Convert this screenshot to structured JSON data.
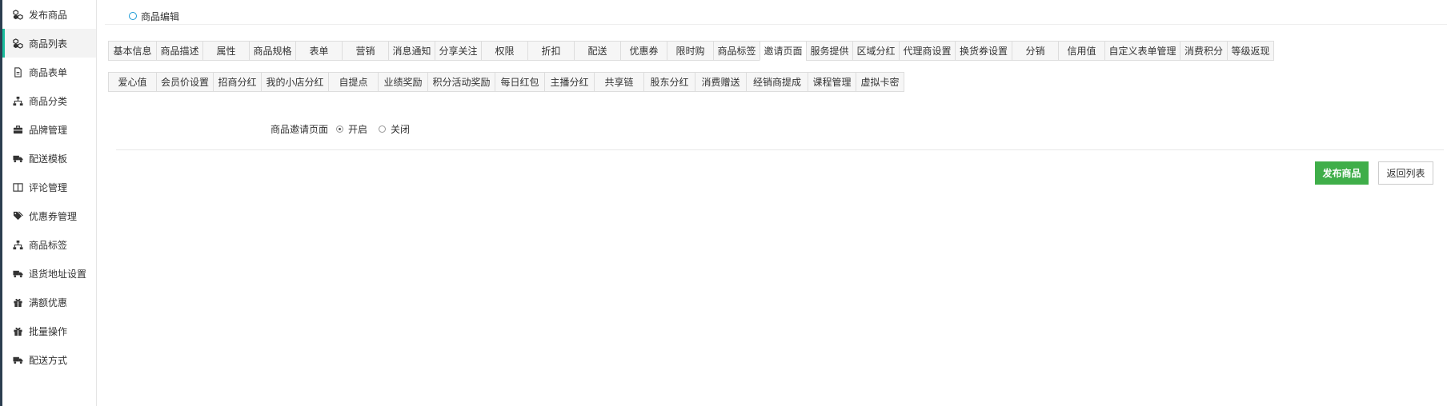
{
  "sidebar": {
    "items": [
      {
        "label": "发布商品",
        "icon": "cubes-icon"
      },
      {
        "label": "商品列表",
        "icon": "cubes-icon"
      },
      {
        "label": "商品表单",
        "icon": "file-icon"
      },
      {
        "label": "商品分类",
        "icon": "sitemap-icon"
      },
      {
        "label": "品牌管理",
        "icon": "briefcase-icon"
      },
      {
        "label": "配送模板",
        "icon": "truck-icon"
      },
      {
        "label": "评论管理",
        "icon": "columns-icon"
      },
      {
        "label": "优惠券管理",
        "icon": "tags-icon"
      },
      {
        "label": "商品标签",
        "icon": "sitemap-icon"
      },
      {
        "label": "退货地址设置",
        "icon": "truck-icon"
      },
      {
        "label": "满额优惠",
        "icon": "gift-icon"
      },
      {
        "label": "批量操作",
        "icon": "gift-icon"
      },
      {
        "label": "配送方式",
        "icon": "truck-icon"
      }
    ],
    "active_index": 1
  },
  "breadcrumb": {
    "label": "商品编辑"
  },
  "tabs": {
    "row1": [
      "基本信息",
      "商品描述",
      "属性",
      "商品规格",
      "表单",
      "营销",
      "消息通知",
      "分享关注",
      "权限",
      "折扣",
      "配送",
      "优惠券",
      "限时购",
      "商品标签",
      "邀请页面",
      "服务提供",
      "区域分红",
      "代理商设置",
      "换货券设置",
      "分销",
      "信用值",
      "自定义表单管理",
      "消费积分",
      "等级返现"
    ],
    "row2": [
      "爱心值",
      "会员价设置",
      "招商分红",
      "我的小店分红",
      "自提点",
      "业绩奖励",
      "积分活动奖励",
      "每日红包",
      "主播分红",
      "共享链",
      "股东分红",
      "消费赠送",
      "经销商提成",
      "课程管理",
      "虚拟卡密"
    ],
    "active": "邀请页面"
  },
  "form": {
    "label": "商品邀请页面",
    "options": [
      {
        "label": "开启",
        "checked": true
      },
      {
        "label": "关闭",
        "checked": false
      }
    ]
  },
  "buttons": {
    "publish": "发布商品",
    "back": "返回列表"
  },
  "colors": {
    "accent": "#1abc9c",
    "primary_button": "#3fae49",
    "crumb_ring": "#1a9ad6"
  }
}
